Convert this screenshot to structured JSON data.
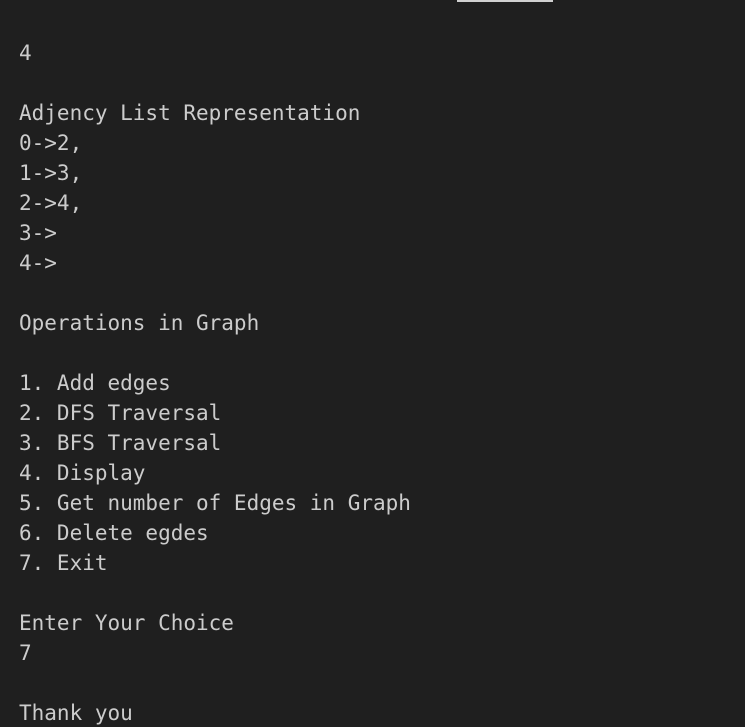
{
  "terminal": {
    "lines": [
      "4",
      "",
      "Adjency List Representation",
      "0->2,",
      "1->3,",
      "2->4,",
      "3->",
      "4->",
      "",
      "Operations in Graph",
      "",
      "1. Add edges",
      "2. DFS Traversal",
      "3. BFS Traversal",
      "4. Display",
      "5. Get number of Edges in Graph",
      "6. Delete egdes",
      "7. Exit",
      "",
      "Enter Your Choice",
      "7",
      "",
      "Thank you"
    ]
  },
  "colors": {
    "background": "#1f1f1f",
    "text": "#cccccc",
    "scroll_indicator": "#d0d0d0"
  }
}
